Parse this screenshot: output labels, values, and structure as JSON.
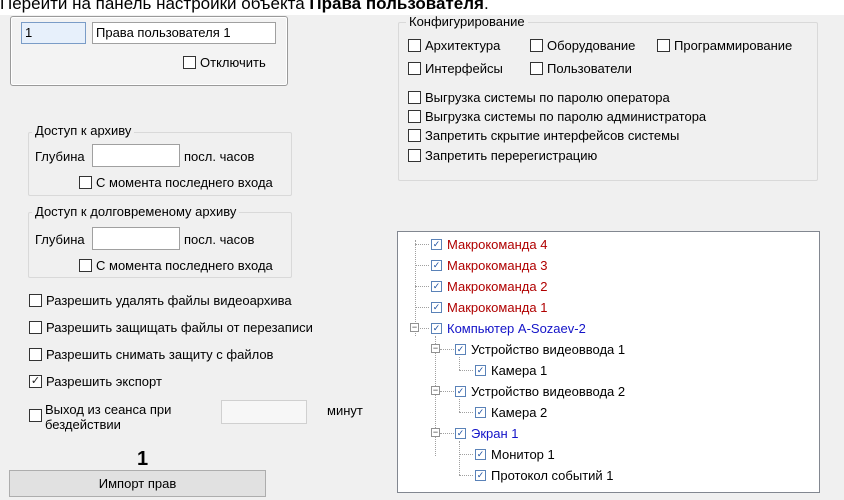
{
  "header": {
    "instruction_text": "Перейти на панель настройки объекта ",
    "instruction_bold": "Права пользователя"
  },
  "object": {
    "id_value": "1",
    "name_value": "Права пользователя 1",
    "disable_label": "Отключить",
    "disable_checked": false
  },
  "archive_access": {
    "title": "Доступ к архиву",
    "depth_label": "Глубина",
    "depth_value": "",
    "units": "посл. часов",
    "since_last_login_label": "С момента последнего входа",
    "since_last_login_checked": false
  },
  "longterm_archive_access": {
    "title": "Доступ к долговременому архиву",
    "depth_label": "Глубина",
    "depth_value": "",
    "units": "посл. часов",
    "since_last_login_label": "С момента последнего входа",
    "since_last_login_checked": false
  },
  "permissions": [
    {
      "label": "Разрешить удалять файлы видеоархива",
      "checked": false
    },
    {
      "label": "Разрешить защищать файлы от перезаписи",
      "checked": false
    },
    {
      "label": "Разрешить снимать защиту с файлов",
      "checked": false
    },
    {
      "label": "Разрешить экспорт",
      "checked": true
    }
  ],
  "idle_logout": {
    "label_line1": "Выход из сеанса при",
    "label_line2": "бездействии",
    "value": "",
    "units": "минут",
    "checked": false
  },
  "callout_number": "1",
  "import_button_label": "Импорт прав",
  "configuration": {
    "title": "Конфигурирование",
    "row1": [
      {
        "label": "Архитектура",
        "checked": false
      },
      {
        "label": "Оборудование",
        "checked": false
      },
      {
        "label": "Программирование",
        "checked": false
      }
    ],
    "row2": [
      {
        "label": "Интерфейсы",
        "checked": false
      },
      {
        "label": "Пользователи",
        "checked": false
      }
    ],
    "options": [
      {
        "label": "Выгрузка системы по паролю оператора",
        "checked": false
      },
      {
        "label": "Выгрузка системы по паролю администратора",
        "checked": false
      },
      {
        "label": "Запретить скрытие интерфейсов системы",
        "checked": false
      },
      {
        "label": "Запретить перерегистрацию",
        "checked": false
      }
    ]
  },
  "tree": {
    "macros": [
      {
        "label": "Макрокоманда 4",
        "checked": true
      },
      {
        "label": "Макрокоманда 3",
        "checked": true
      },
      {
        "label": "Макрокоманда 2",
        "checked": true
      },
      {
        "label": "Макрокоманда 1",
        "checked": true
      }
    ],
    "computer": {
      "label": "Компьютер A-Sozaev-2",
      "checked": true
    },
    "capture1": {
      "label": "Устройство видеоввода 1",
      "checked": true
    },
    "camera1": {
      "label": "Камера 1",
      "checked": true
    },
    "capture2": {
      "label": "Устройство видеоввода 2",
      "checked": true
    },
    "camera2": {
      "label": "Камера 2",
      "checked": true
    },
    "screen": {
      "label": "Экран 1",
      "checked": true
    },
    "monitor": {
      "label": "Монитор 1",
      "checked": true
    },
    "event_log": {
      "label": "Протокол событий 1",
      "checked": true
    }
  },
  "colors": {
    "macro_text": "#b00000",
    "node_blue": "#1414c8",
    "panel_bg": "#f0f0f0"
  }
}
